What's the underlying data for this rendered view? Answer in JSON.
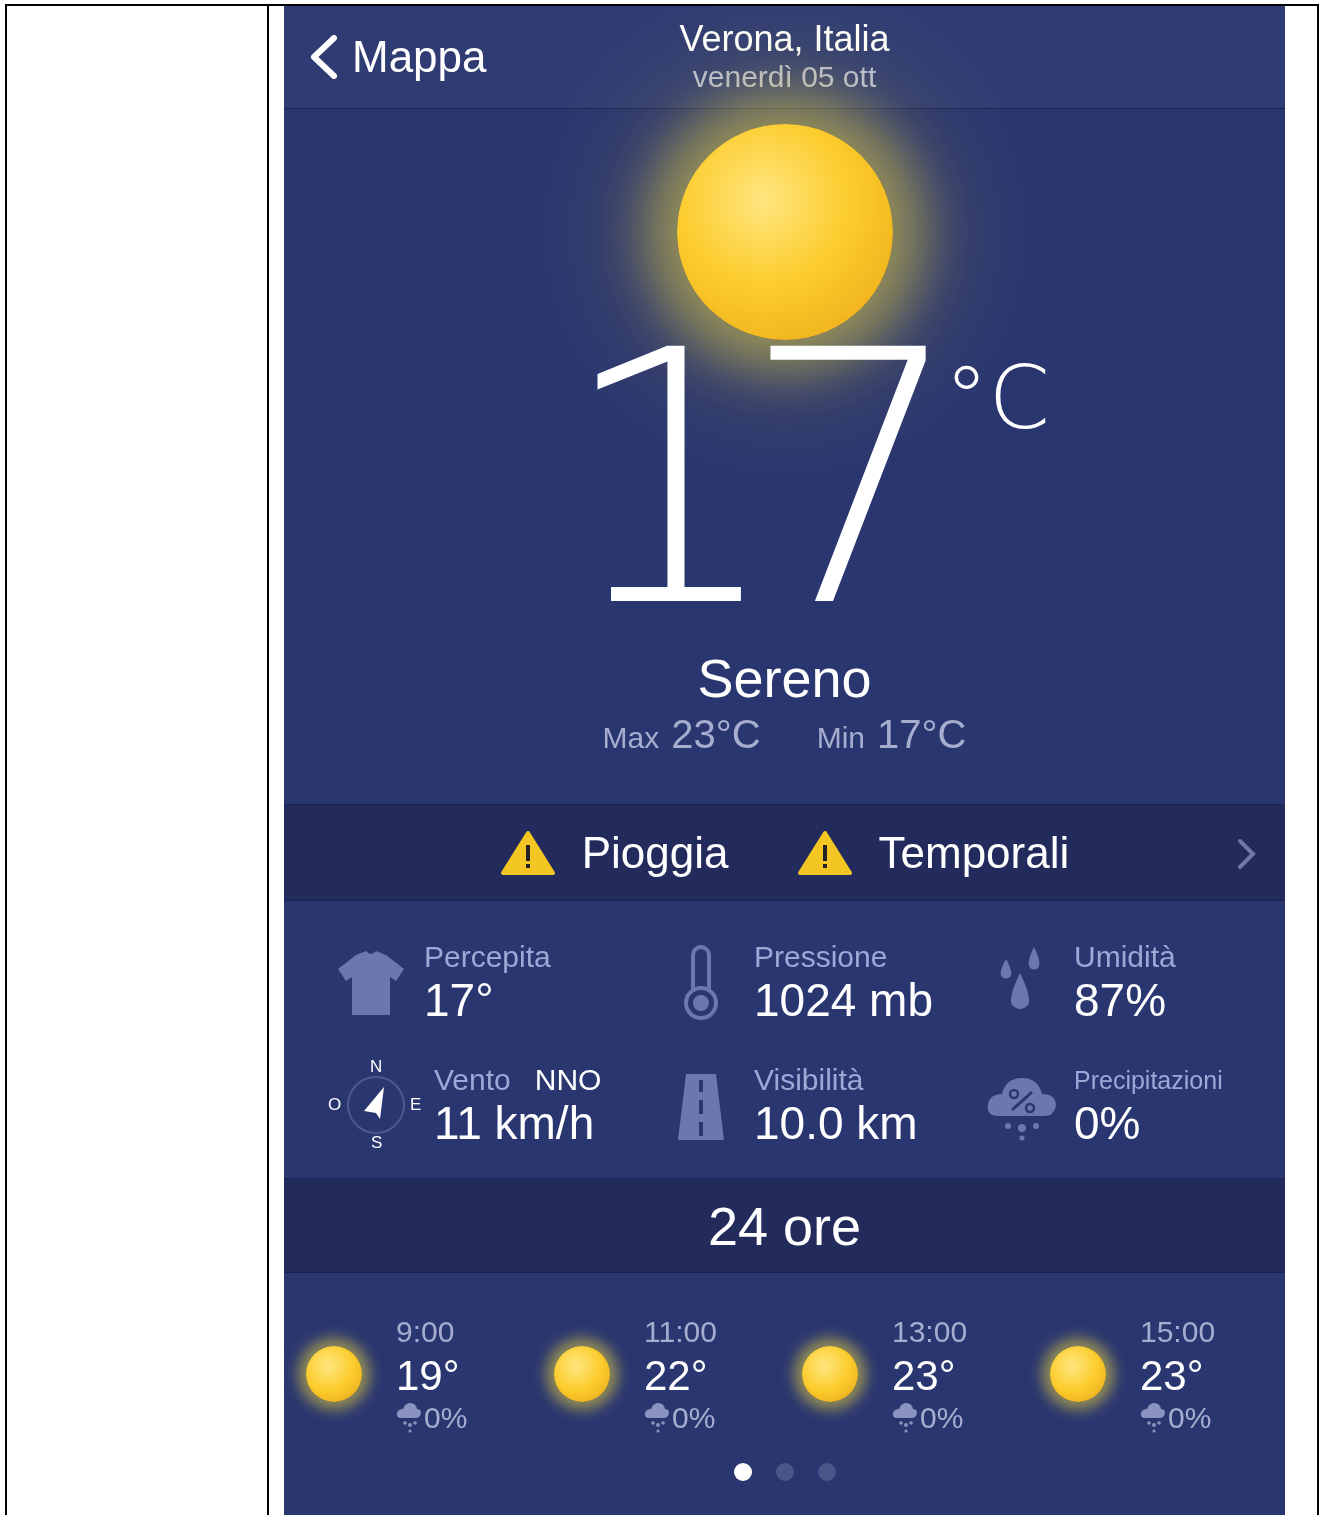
{
  "header": {
    "back": "Mappa",
    "city": "Verona, Italia",
    "date": "venerdì 05 ott"
  },
  "current": {
    "temperature": "17",
    "unit": "°C",
    "condition": "Sereno",
    "max_label": "Max",
    "max": "23°C",
    "min_label": "Min",
    "min": "17°C"
  },
  "alerts": [
    {
      "label": "Pioggia"
    },
    {
      "label": "Temporali"
    }
  ],
  "details": [
    {
      "kind": "shirt",
      "label": "Percepita",
      "value": "17°"
    },
    {
      "kind": "thermometer",
      "label": "Pressione",
      "value": "1024 mb"
    },
    {
      "kind": "drops",
      "label": "Umidità",
      "value": "87%"
    },
    {
      "kind": "compass",
      "label": "Vento",
      "direction": "NNO",
      "value": "11 km/h",
      "compass": {
        "n": "N",
        "o": "O",
        "e": "E",
        "s": "S"
      }
    },
    {
      "kind": "road",
      "label": "Visibilità",
      "value": "10.0 km"
    },
    {
      "kind": "rain",
      "label": "Precipitazioni",
      "value": "0%"
    }
  ],
  "section_title": "24 ore",
  "hourly": [
    {
      "time": "9:00",
      "temp": "19°",
      "rain": "0%"
    },
    {
      "time": "11:00",
      "temp": "22°",
      "rain": "0%"
    },
    {
      "time": "13:00",
      "temp": "23°",
      "rain": "0%"
    },
    {
      "time": "15:00",
      "temp": "23°",
      "rain": "0%"
    }
  ],
  "pages": [
    {
      "selected": true
    },
    {
      "selected": false
    },
    {
      "selected": false
    }
  ]
}
